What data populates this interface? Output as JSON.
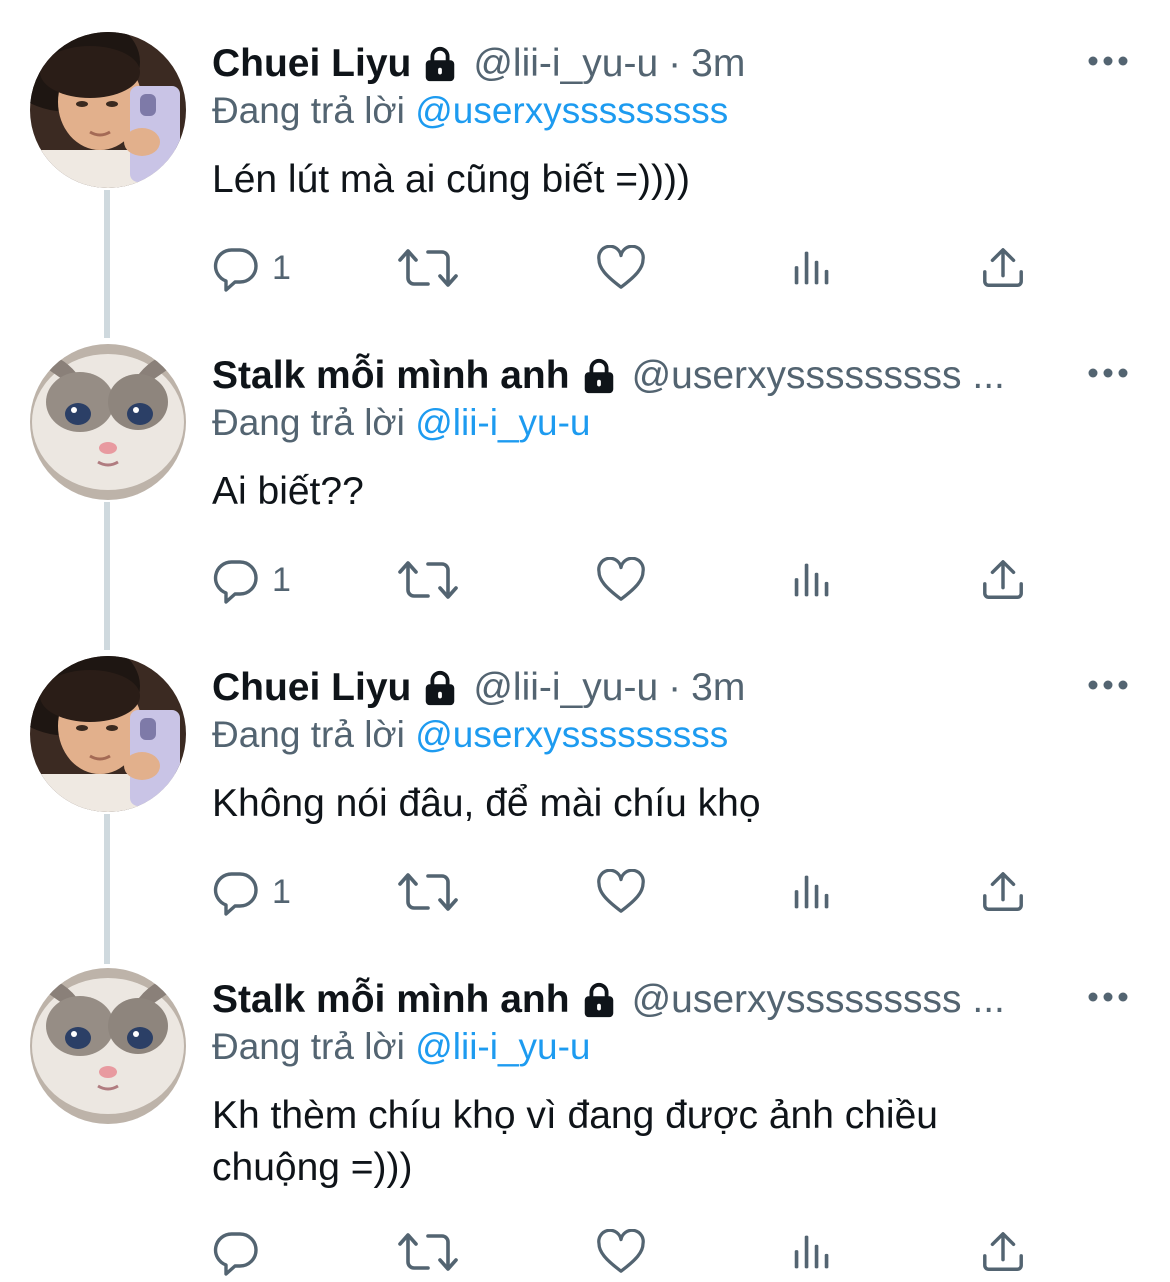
{
  "tweets": [
    {
      "name": "Chuei Liyu",
      "handle": "@lii-i_yu-u",
      "separator": "·",
      "time": "3m",
      "reply_prefix": "Đang trả lời",
      "reply_to": "@userxysssssssss",
      "text": "Lén lút mà ai cũng biết =))))",
      "reply_count": "1",
      "avatar": "boy-mirror-selfie"
    },
    {
      "name": "Stalk mỗi mình anh",
      "handle": "@userxysssssssss ...",
      "reply_prefix": "Đang trả lời",
      "reply_to": "@lii-i_yu-u",
      "text": "Ai biết??",
      "reply_count": "1",
      "avatar": "crying-cat"
    },
    {
      "name": "Chuei Liyu",
      "handle": "@lii-i_yu-u",
      "separator": "·",
      "time": "3m",
      "reply_prefix": "Đang trả lời",
      "reply_to": "@userxysssssssss",
      "text": "Không nói đâu, để mài chíu khọ",
      "reply_count": "1",
      "avatar": "boy-mirror-selfie"
    },
    {
      "name": "Stalk mỗi mình anh",
      "handle": "@userxysssssssss ...",
      "reply_prefix": "Đang trả lời",
      "reply_to": "@lii-i_yu-u",
      "text": "Kh thèm chíu khọ vì đang được ảnh chiều chuộng =)))",
      "reply_count": "",
      "avatar": "crying-cat"
    }
  ],
  "colors": {
    "text_primary": "#0f1419",
    "text_secondary": "#536471",
    "mention": "#1d9bf0",
    "thread_line": "#cfd9de"
  },
  "icons": [
    "lock-icon",
    "more-icon",
    "reply-icon",
    "retweet-icon",
    "like-icon",
    "views-icon",
    "share-icon"
  ]
}
